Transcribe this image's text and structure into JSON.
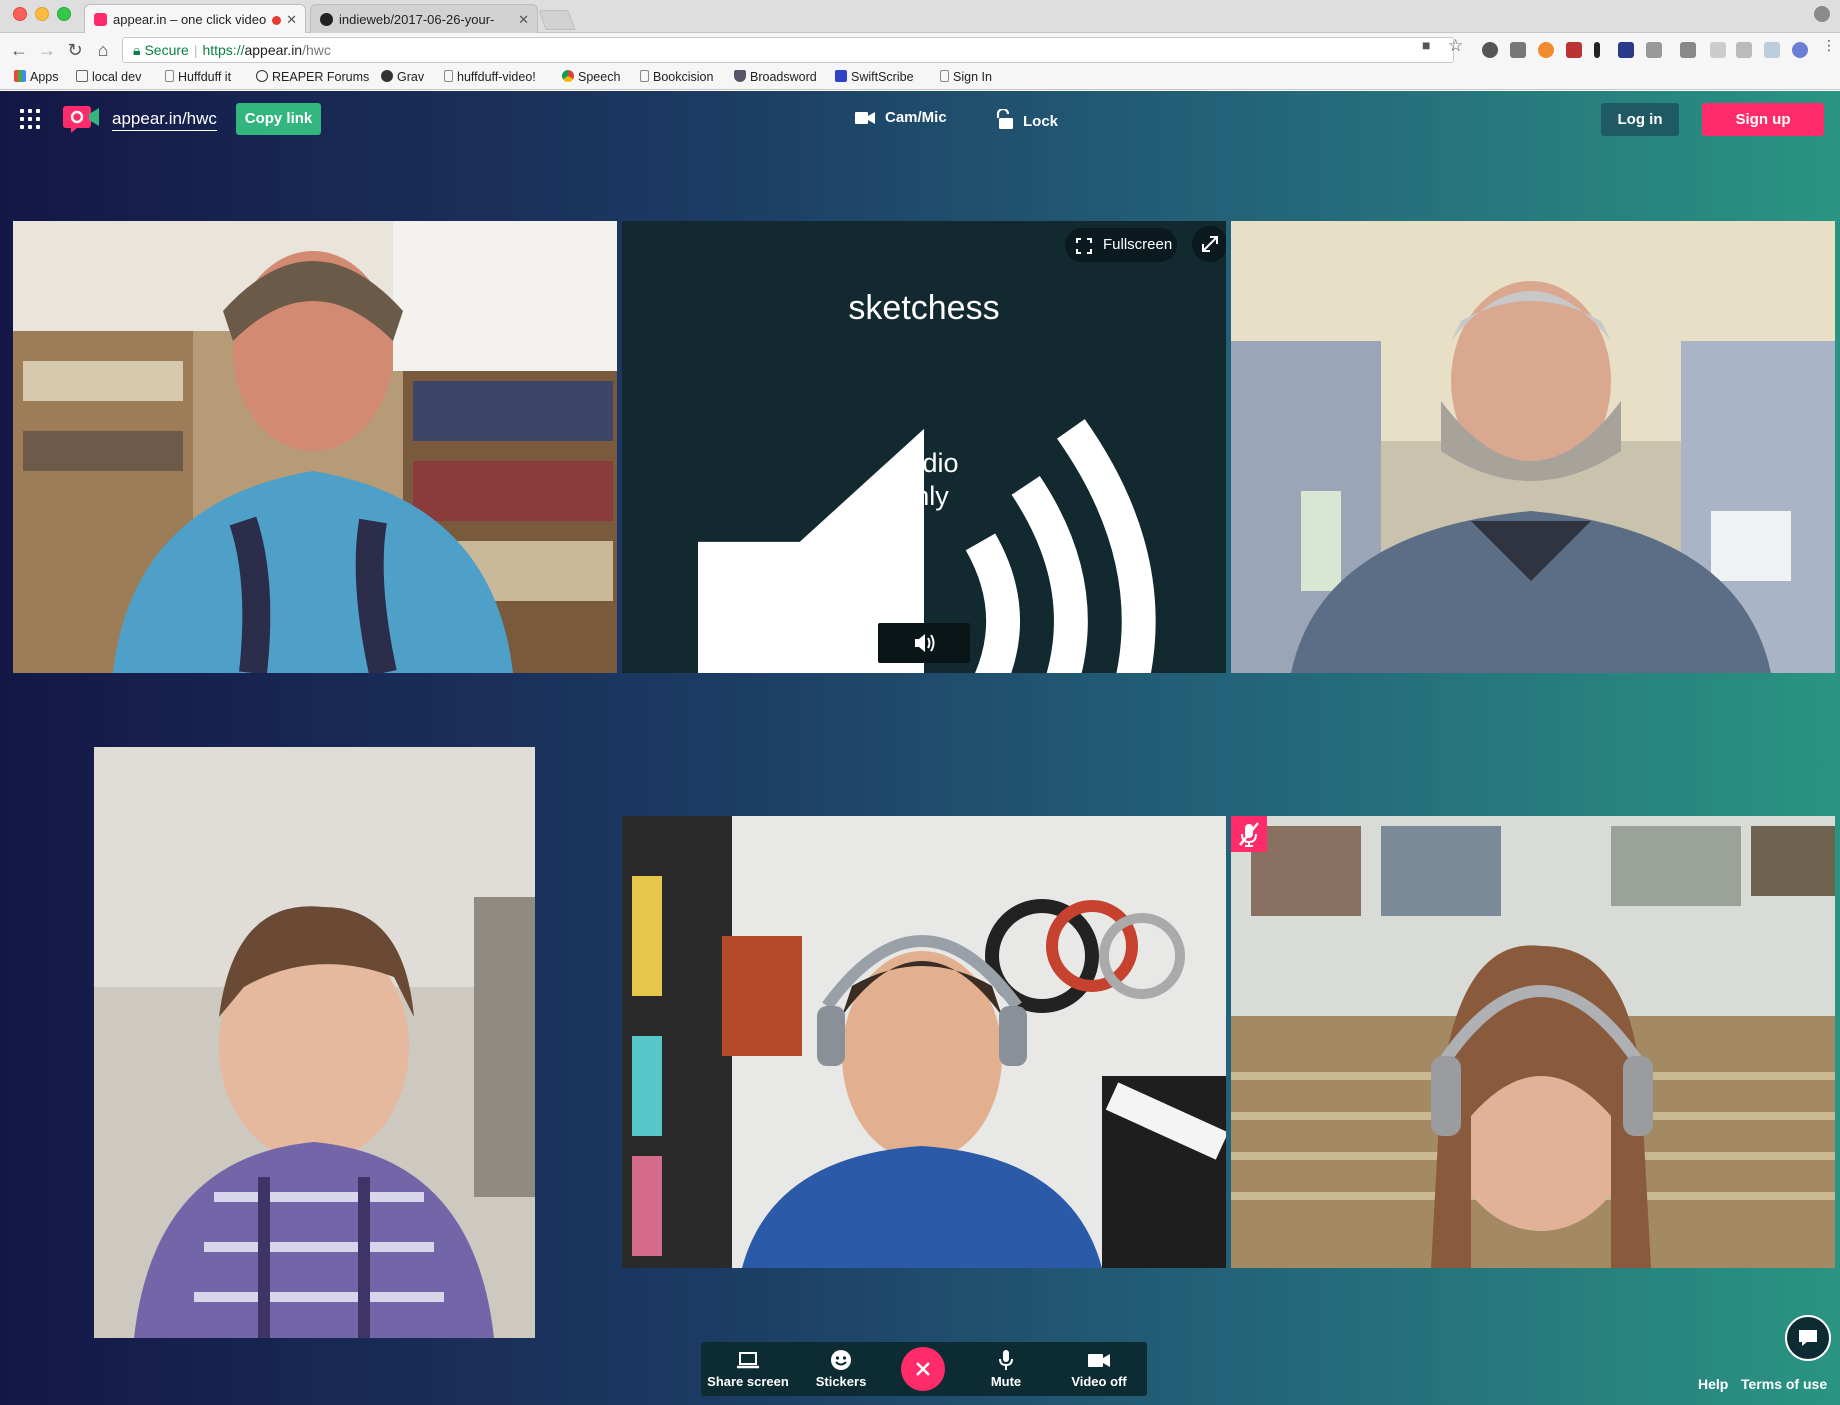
{
  "browser": {
    "tabs": [
      {
        "title": "appear.in – one click video",
        "active": true
      },
      {
        "title": "indieweb/2017-06-26-your-",
        "active": false
      }
    ],
    "address": {
      "secure_label": "Secure",
      "scheme": "https://",
      "host": "appear.in",
      "path": "/hwc"
    },
    "bookmarks": [
      {
        "label": "Apps",
        "icon": "apps-grid-icon"
      },
      {
        "label": "local dev",
        "icon": "folder-icon"
      },
      {
        "label": "Huffduff it",
        "icon": "page-icon"
      },
      {
        "label": "REAPER Forums",
        "icon": "reaper-icon"
      },
      {
        "label": "Grav",
        "icon": "grav-icon"
      },
      {
        "label": "huffduff-video!",
        "icon": "page-icon"
      },
      {
        "label": "Speech",
        "icon": "chrome-icon"
      },
      {
        "label": "Bookcision",
        "icon": "page-icon"
      },
      {
        "label": "Broadsword",
        "icon": "shield-icon"
      },
      {
        "label": "SwiftScribe",
        "icon": "swiftscribe-icon"
      },
      {
        "label": "Sign In",
        "icon": "page-icon"
      }
    ]
  },
  "app": {
    "room_link": "appear.in/hwc",
    "copy_link_label": "Copy link",
    "cam_mic_label": "Cam/Mic",
    "lock_label": "Lock",
    "login_label": "Log in",
    "signup_label": "Sign up",
    "brand_color": "#ff2b6b",
    "accent_green": "#32b57f"
  },
  "tiles": [
    {
      "kind": "video",
      "label": "participant-1",
      "muted": false
    },
    {
      "kind": "audio",
      "name": "sketchess",
      "status_line1": "Audio",
      "status_line2": "only",
      "fullscreen_label": "Fullscreen"
    },
    {
      "kind": "video",
      "label": "participant-3",
      "muted": false
    },
    {
      "kind": "video",
      "label": "participant-4",
      "muted": false
    },
    {
      "kind": "video",
      "label": "participant-5",
      "muted": false
    },
    {
      "kind": "video",
      "label": "participant-6",
      "muted": true
    }
  ],
  "controls": {
    "share_screen": "Share screen",
    "stickers": "Stickers",
    "mute": "Mute",
    "video_off": "Video off"
  },
  "footer": {
    "help": "Help",
    "terms": "Terms of use"
  }
}
